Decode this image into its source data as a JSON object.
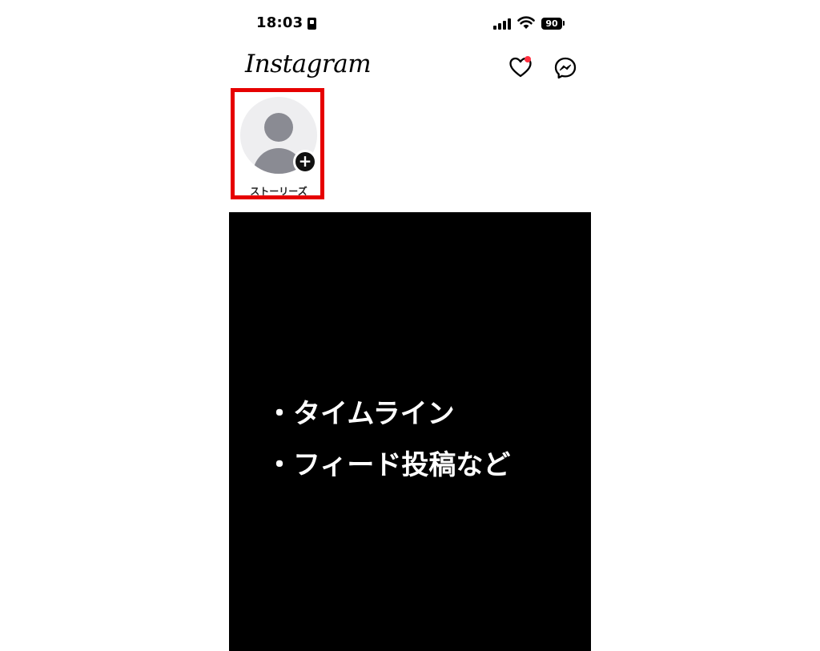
{
  "status_bar": {
    "time": "18:03",
    "battery": "90"
  },
  "header": {
    "logo": "Instagram",
    "icons": [
      "heart-icon",
      "messenger-icon"
    ],
    "notification_dot_color": "#ff3040"
  },
  "stories": {
    "items": [
      {
        "label": "ストーリーズ",
        "icon": "add-icon"
      }
    ],
    "highlight_color": "#e60000"
  },
  "feed": {
    "caption_lines": [
      "・タイムライン",
      "・フィード投稿など"
    ]
  }
}
